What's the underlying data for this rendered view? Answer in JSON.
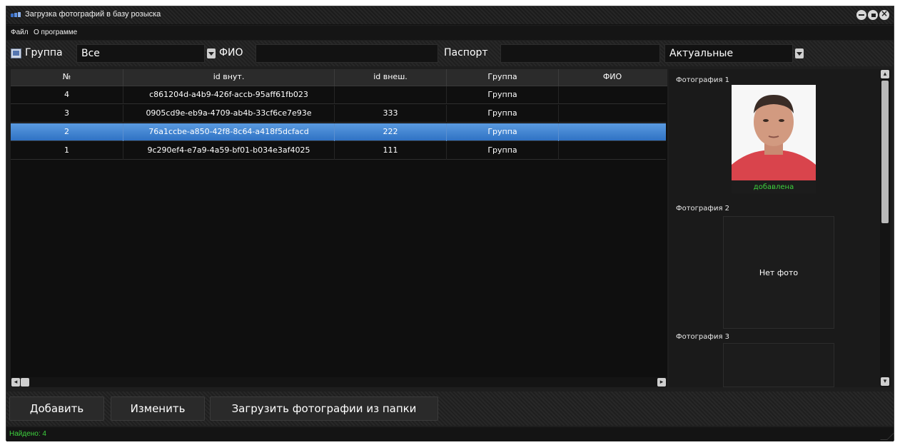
{
  "window": {
    "title": "Загрузка фотографий в базу розыска"
  },
  "menu": {
    "file": "Файл",
    "about": "О программе"
  },
  "filters": {
    "group_label": "Группа",
    "group_value": "Все",
    "fio_label": "ФИО",
    "fio_value": "",
    "passport_label": "Паспорт",
    "passport_value": "",
    "status_value": "Актуальные"
  },
  "table": {
    "columns": [
      "№",
      "id внут.",
      "id внеш.",
      "Группа",
      "ФИО"
    ],
    "rows": [
      {
        "num": "4",
        "id_int": "c861204d-a4b9-426f-accb-95aff61fb023",
        "id_ext": "",
        "group": "Группа",
        "fio": ""
      },
      {
        "num": "3",
        "id_int": "0905cd9e-eb9a-4709-ab4b-33cf6ce7e93e",
        "id_ext": "333",
        "group": "Группа",
        "fio": ""
      },
      {
        "num": "2",
        "id_int": "76a1ccbe-a850-42f8-8c64-a418f5dcfacd",
        "id_ext": "222",
        "group": "Группа",
        "fio": ""
      },
      {
        "num": "1",
        "id_int": "9c290ef4-e7a9-4a59-bf01-b034e3af4025",
        "id_ext": "111",
        "group": "Группа",
        "fio": ""
      }
    ],
    "selected_row": 2
  },
  "photos": [
    {
      "title": "Фотография 1",
      "status": "добавлена",
      "has_photo": true
    },
    {
      "title": "Фотография 2",
      "placeholder": "Нет фото",
      "has_photo": false
    },
    {
      "title": "Фотография 3",
      "has_photo": false
    }
  ],
  "buttons": {
    "add": "Добавить",
    "edit": "Изменить",
    "load_folder": "Загрузить фотографии из папки"
  },
  "status": {
    "found": "Найдено: 4"
  },
  "colors": {
    "selection": "#3a7fd2",
    "status_green": "#3ed23e",
    "background": "#1e1e1e"
  }
}
